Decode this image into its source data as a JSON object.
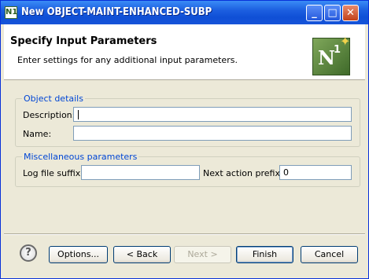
{
  "window": {
    "title": "New OBJECT-MAINT-ENHANCED-SUBP",
    "icon_label": "N1",
    "controls": [
      "minimize-icon",
      "maximize-icon",
      "close-icon"
    ]
  },
  "header": {
    "title": "Specify Input Parameters",
    "description": "Enter settings for any additional input parameters.",
    "logo": {
      "letter": "N",
      "superscript": "1",
      "icon": "star-icon"
    }
  },
  "object_details": {
    "title": "Object details",
    "description_label": "Description:",
    "description_value": "",
    "name_label": "Name:",
    "name_value": ""
  },
  "misc": {
    "title": "Miscellaneous parameters",
    "log_suffix_label": "Log file suffix:",
    "log_suffix_value": "",
    "next_prefix_label": "Next action prefix:",
    "next_prefix_value": "0"
  },
  "footer": {
    "help_glyph": "?",
    "options_label": "Options...",
    "back_label": "< Back",
    "next_label": "Next >",
    "finish_label": "Finish",
    "cancel_label": "Cancel"
  },
  "colors": {
    "title_bar": "#1c5fe0",
    "group_title": "#0046d5",
    "dialog_bg": "#ece9d8"
  }
}
